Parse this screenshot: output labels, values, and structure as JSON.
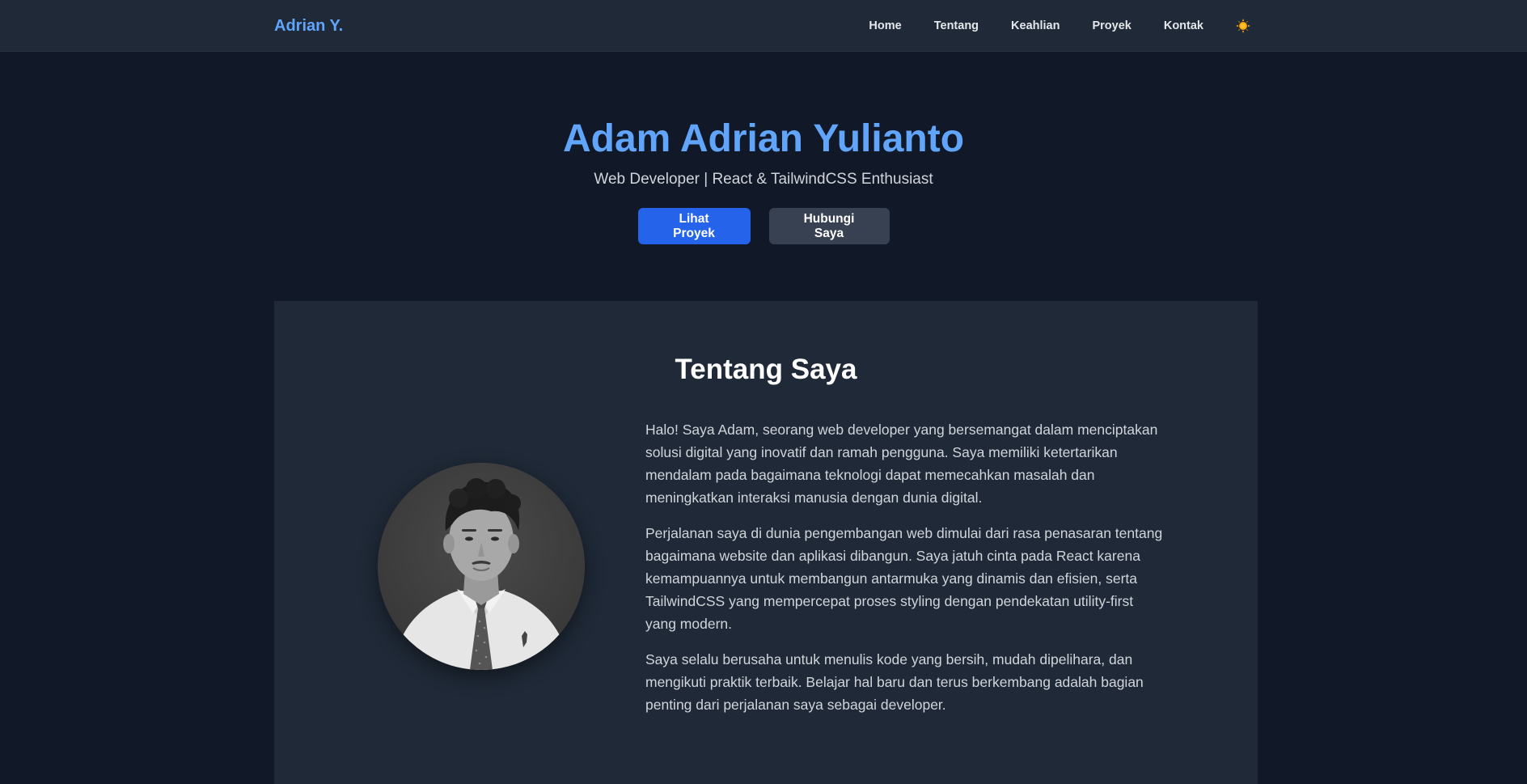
{
  "navbar": {
    "brand": "Adrian Y.",
    "links": [
      "Home",
      "Tentang",
      "Keahlian",
      "Proyek",
      "Kontak"
    ],
    "theme_icon": "sun-icon"
  },
  "hero": {
    "title": "Adam Adrian Yulianto",
    "subtitle": "Web Developer | React & TailwindCSS Enthusiast",
    "primary_button": "Lihat Proyek",
    "secondary_button": "Hubungi Saya"
  },
  "about": {
    "title": "Tentang Saya",
    "paragraphs": [
      "Halo! Saya Adam, seorang web developer yang bersemangat dalam menciptakan solusi digital yang inovatif dan ramah pengguna. Saya memiliki ketertarikan mendalam pada bagaimana teknologi dapat memecahkan masalah dan meningkatkan interaksi manusia dengan dunia digital.",
      "Perjalanan saya di dunia pengembangan web dimulai dari rasa penasaran tentang bagaimana website dan aplikasi dibangun. Saya jatuh cinta pada React karena kemampuannya untuk membangun antarmuka yang dinamis dan efisien, serta TailwindCSS yang mempercepat proses styling dengan pendekatan utility-first yang modern.",
      "Saya selalu berusaha untuk menulis kode yang bersih, mudah dipelihara, dan mengikuti praktik terbaik. Belajar hal baru dan terus berkembang adalah bagian penting dari perjalanan saya sebagai developer."
    ]
  },
  "colors": {
    "page_bg": "#111827",
    "surface": "#1f2937",
    "accent": "#60a5fa",
    "primary_button": "#2563eb",
    "secondary_button": "#374151"
  }
}
